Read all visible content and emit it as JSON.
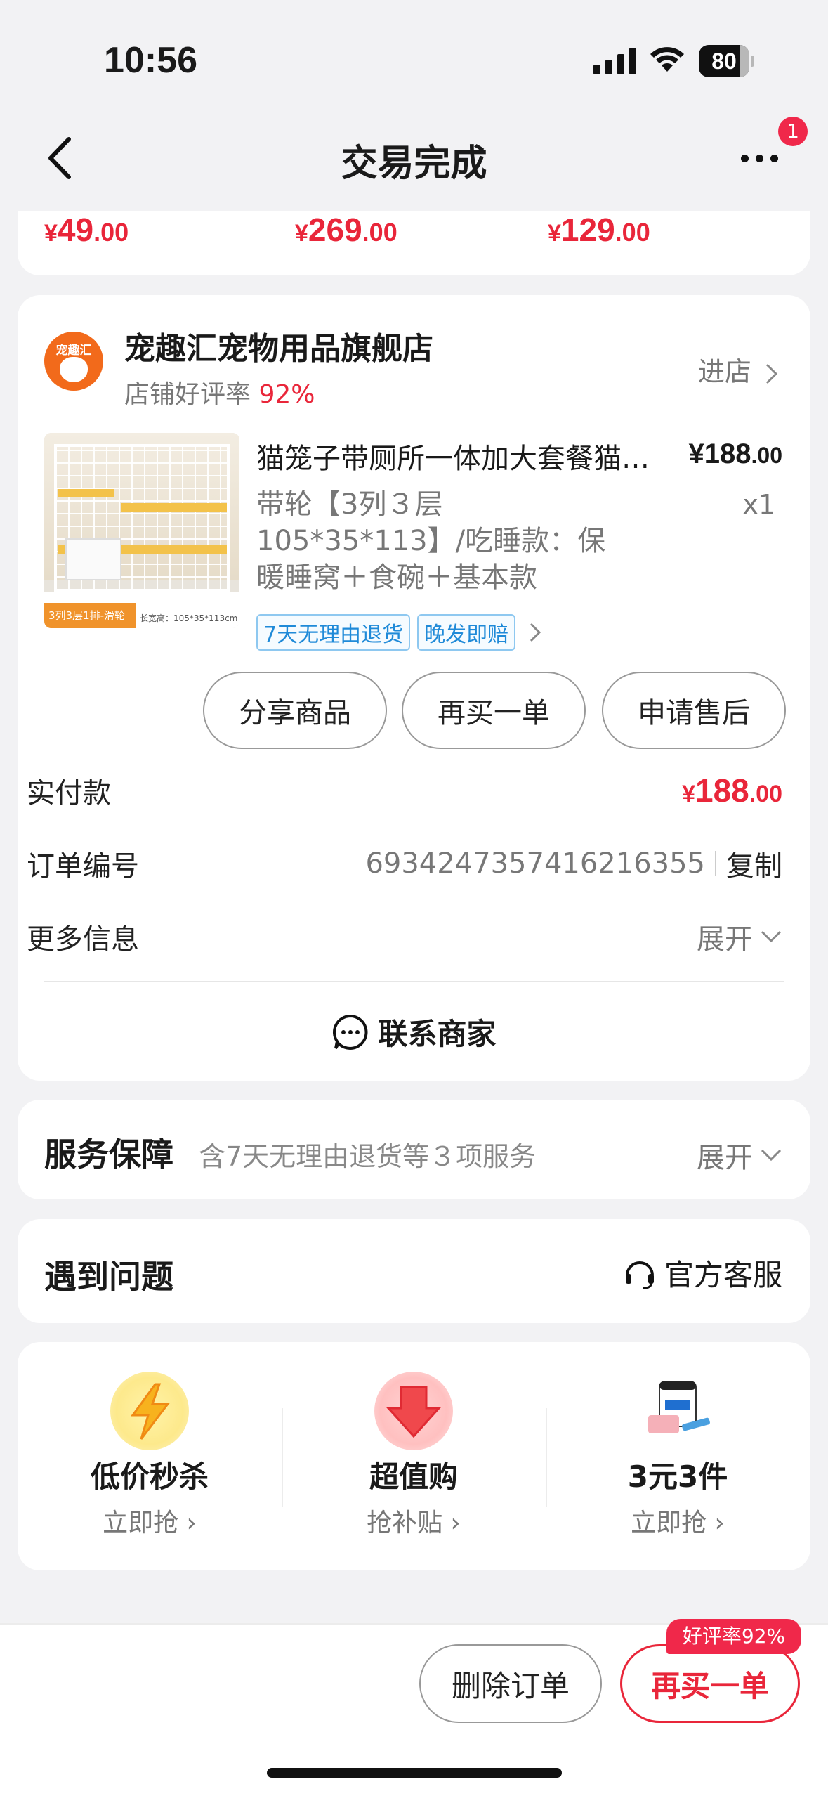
{
  "status_bar": {
    "time": "10:56",
    "battery": "80"
  },
  "nav": {
    "title": "交易完成",
    "badge": "1"
  },
  "price_strip": [
    {
      "yen": "¥",
      "int": "49",
      "dec": ".00"
    },
    {
      "yen": "¥",
      "int": "269",
      "dec": ".00"
    },
    {
      "yen": "¥",
      "int": "129",
      "dec": ".00"
    }
  ],
  "shop": {
    "logo_text": "宠趣汇",
    "name": "宠趣汇宠物用品旗舰店",
    "rate_label": "店铺好评率",
    "rate_value": "92%",
    "enter": "进店"
  },
  "item": {
    "thumb_tag": "3列3层1排-滑轮",
    "thumb_dim": "长宽高：105*35*113cm",
    "title": "猫笼子带厕所一体加大套餐猫别墅",
    "spec": "带轮【3列３层105*35*113】/吃睡款：保暖睡窝＋食碗＋基本款",
    "price_yen": "¥",
    "price_int": "188",
    "price_dec": ".00",
    "qty": "x1",
    "tags": [
      "7天无理由退货",
      "晚发即赔"
    ]
  },
  "actions": {
    "share": "分享商品",
    "rebuy": "再买一单",
    "after_sale": "申请售后"
  },
  "paid": {
    "label": "实付款",
    "yen": "¥",
    "int": "188",
    "dec": ".00"
  },
  "order_no": {
    "label": "订单编号",
    "value": "6934247357416216355",
    "copy": "复制"
  },
  "more_info": {
    "label": "更多信息",
    "expand": "展开"
  },
  "contact": "联系商家",
  "service": {
    "title": "服务保障",
    "desc": "含7天无理由退货等３项服务",
    "expand": "展开"
  },
  "problem": {
    "title": "遇到问题",
    "cs": "官方客服"
  },
  "promos": [
    {
      "title": "低价秒杀",
      "sub": "立即抢",
      "icon": "lightning-icon"
    },
    {
      "title": "超值购",
      "sub": "抢补贴",
      "icon": "down-arrow-icon"
    },
    {
      "title": "3元3件",
      "sub": "立即抢",
      "icon": "product-pack-icon"
    }
  ],
  "bottom": {
    "delete": "删除订单",
    "rebuy": "再买一单",
    "rate_bubble": "好评率92%"
  },
  "colors": {
    "accent": "#e9263a",
    "tag_blue": "#1f8ad8",
    "bg": "#f2f2f4"
  }
}
